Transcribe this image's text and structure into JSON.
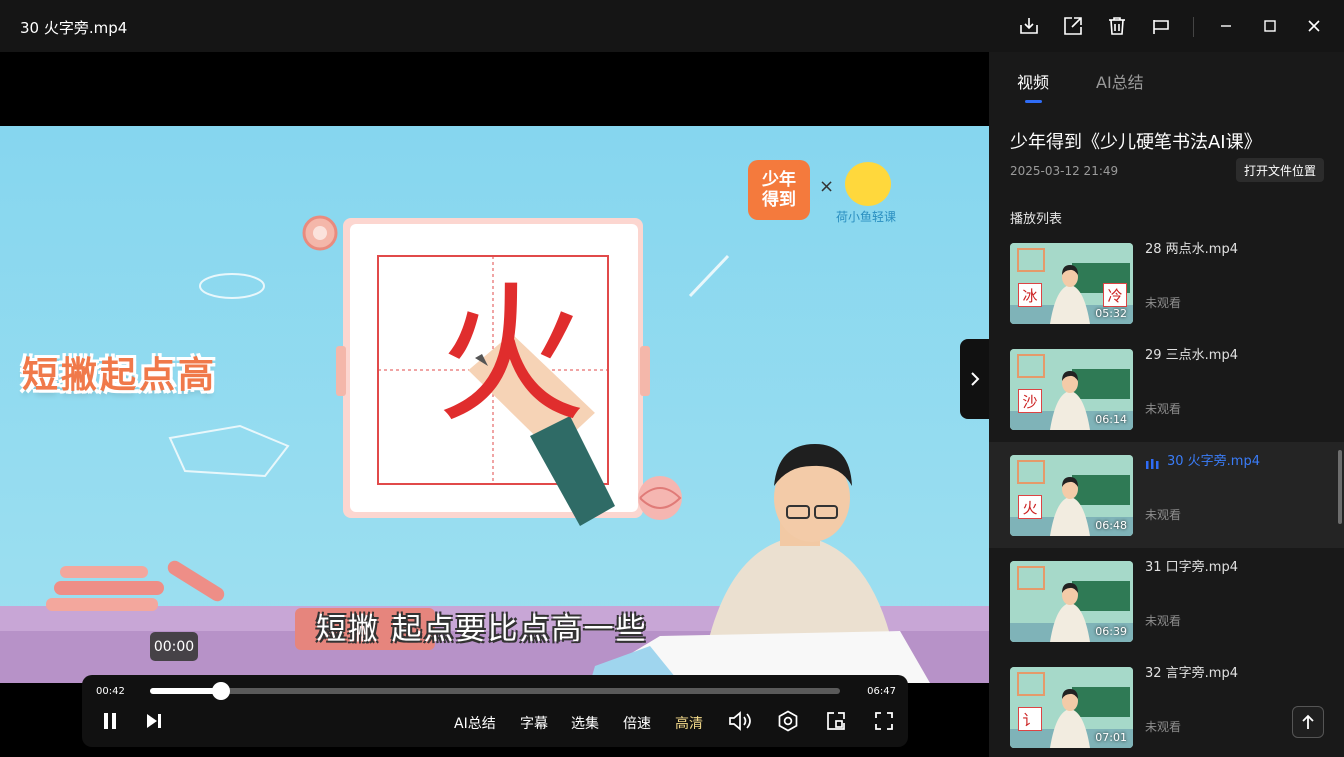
{
  "window": {
    "title": "30 火字旁.mp4"
  },
  "colors": {
    "accent": "#2f6cf6",
    "hd_highlight": "#f2d98a",
    "panel_bg": "#191919"
  },
  "titlebar_icons": [
    "download-icon",
    "share-icon",
    "delete-icon",
    "pin-icon",
    "minimize-icon",
    "maximize-icon",
    "close-icon"
  ],
  "video": {
    "logo_brand": "少年得到",
    "logo_times": "×",
    "logo_partner": "荷小鱼轻课",
    "slogan": "短撇起点高",
    "character": "火",
    "subtitle": "短撇 起点要比点高一些"
  },
  "player": {
    "hover_time": "00:00",
    "current_time": "00:42",
    "duration": "06:47",
    "progress": 0.103,
    "buttons": {
      "ai": "AI总结",
      "subtitles": "字幕",
      "episodes": "选集",
      "speed": "倍速",
      "quality": "高清"
    }
  },
  "panel": {
    "tabs": {
      "video": "视频",
      "ai": "AI总结"
    },
    "course_title": "少年得到《少儿硬笔书法AI课》",
    "date": "2025-03-12 21:49",
    "open_folder": "打开文件位置",
    "playlist_label": "播放列表",
    "items": [
      {
        "name": "28 两点水.mp4",
        "duration": "05:32",
        "status": "未观看",
        "chars": [
          "冰",
          "冷"
        ],
        "active": false
      },
      {
        "name": "29 三点水.mp4",
        "duration": "06:14",
        "status": "未观看",
        "chars": [
          "沙"
        ],
        "active": false
      },
      {
        "name": "30 火字旁.mp4",
        "duration": "06:48",
        "status": "未观看",
        "chars": [
          "火"
        ],
        "active": true
      },
      {
        "name": "31 口字旁.mp4",
        "duration": "06:39",
        "status": "未观看",
        "chars": [],
        "active": false
      },
      {
        "name": "32 言字旁.mp4",
        "duration": "07:01",
        "status": "未观看",
        "chars": [
          "讠"
        ],
        "active": false
      }
    ]
  }
}
